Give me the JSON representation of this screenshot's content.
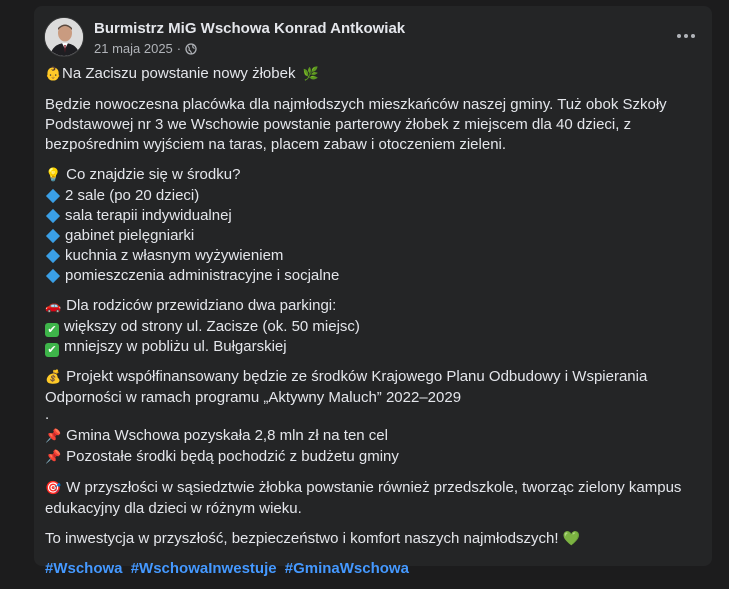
{
  "post": {
    "author": "Burmistrz MiG Wschowa Konrad Antkowiak",
    "date": "21 maja 2025",
    "separator": "·",
    "privacy_icon": "globe-icon",
    "more_icon": "more-options-icon"
  },
  "content": {
    "headline": "Na Zaciszu powstanie nowy żłobek",
    "intro_lines": [
      "Będzie nowoczesna placówka dla najmłodszych mieszkańców naszej gminy. Tuż obok Szkoły",
      "Podstawowej nr 3 we Wschowie powstanie parterowy żłobek z miejscem dla 40 dzieci, z",
      "bezpośrednim wyjściem na taras, placem zabaw i otoczeniem zieleni."
    ],
    "inside_heading": "Co znajdzie się w środku?",
    "inside_items": [
      "2 sale (po 20 dzieci)",
      "sala terapii indywidualnej",
      "gabinet pielęgniarki",
      "kuchnia z własnym wyżywieniem",
      "pomieszczenia administracyjne i socjalne"
    ],
    "parking_heading": "Dla rodziców przewidziano dwa parkingi:",
    "parking_items": [
      "większy od strony ul. Zacisze (ok. 50 miejsc)",
      "mniejszy w pobliżu ul. Bułgarskiej"
    ],
    "funding_lines": [
      "Projekt współfinansowany będzie ze środków Krajowego Planu Odbudowy i Wspierania",
      "Odporności w ramach programu „Aktywny Maluch” 2022–2029"
    ],
    "dot_line": ".",
    "money_items": [
      "Gmina Wschowa pozyskała 2,8 mln zł na ten cel",
      "Pozostałe środki będą pochodzić z budżetu gminy"
    ],
    "future_lines": [
      "W przyszłości w sąsiedztwie żłobka powstanie również przedszkole, tworząc zielony kampus",
      "edukacyjny dla dzieci w różnym wieku."
    ],
    "closing": "To inwestycja w przyszłość, bezpieczeństwo i komfort naszych najmłodszych!",
    "hashtags": [
      "#Wschowa",
      "#WschowaInwestuje",
      "#GminaWschowa"
    ]
  },
  "emoji": {
    "baby": "👶",
    "herb": "🌿",
    "bulb": "💡",
    "car": "🚗",
    "check": "✔",
    "moneybag": "💰",
    "pin": "📌",
    "target": "🎯",
    "heart": "💚"
  },
  "colors": {
    "background": "#1c1c1d",
    "card": "#242526",
    "text": "#e4e6eb",
    "secondary_text": "#b0b3b8",
    "hashtag": "#4599ff",
    "diamond": "#3a9fe6",
    "check": "#3eb54a"
  }
}
